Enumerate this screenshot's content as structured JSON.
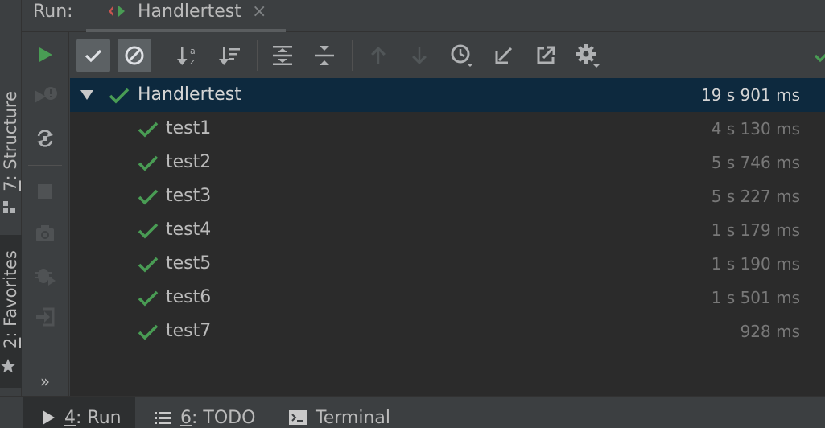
{
  "header": {
    "run_label": "Run:",
    "tab_title": "Handlertest",
    "tab_close": "×"
  },
  "left_strip": {
    "structure_mnemonic": "7",
    "structure_label": ": Structure",
    "favorites_mnemonic": "2",
    "favorites_label": ": Favorites"
  },
  "actions": {
    "more": "»"
  },
  "toolbar": {
    "buttons": [
      {
        "icon": "show-passed-icon",
        "pressed": true
      },
      {
        "icon": "show-ignored-icon",
        "pressed": true
      },
      {
        "icon": "sort-alphabetically-icon",
        "pressed": false
      },
      {
        "icon": "sort-by-duration-icon",
        "pressed": false
      },
      {
        "icon": "expand-all-icon",
        "pressed": false
      },
      {
        "icon": "collapse-all-icon",
        "pressed": false
      },
      {
        "icon": "previous-failed-icon",
        "pressed": false
      },
      {
        "icon": "next-failed-icon",
        "pressed": false
      },
      {
        "icon": "test-history-icon",
        "pressed": false
      },
      {
        "icon": "import-tests-icon",
        "pressed": false
      },
      {
        "icon": "export-results-icon",
        "pressed": false
      },
      {
        "icon": "settings-icon",
        "pressed": false
      }
    ]
  },
  "tree": {
    "root": {
      "name": "Handlertest",
      "time": "19 s 901 ms",
      "status": "passed"
    },
    "tests": [
      {
        "name": "test1",
        "time": "4 s 130 ms",
        "status": "passed"
      },
      {
        "name": "test2",
        "time": "5 s 746 ms",
        "status": "passed"
      },
      {
        "name": "test3",
        "time": "5 s 227 ms",
        "status": "passed"
      },
      {
        "name": "test4",
        "time": "1 s 179 ms",
        "status": "passed"
      },
      {
        "name": "test5",
        "time": "1 s 190 ms",
        "status": "passed"
      },
      {
        "name": "test6",
        "time": "1 s 501 ms",
        "status": "passed"
      },
      {
        "name": "test7",
        "time": "928 ms",
        "status": "passed"
      }
    ]
  },
  "bottom_bar": {
    "tabs": [
      {
        "mnemonic": "4",
        "label": ": Run",
        "active": true
      },
      {
        "mnemonic": "6",
        "label": ": TODO",
        "active": false
      },
      {
        "mnemonic": "",
        "label": "Terminal",
        "active": false
      }
    ]
  },
  "colors": {
    "pass_green": "#499c54",
    "run_green": "#499c54",
    "selection": "#0d293e",
    "background": "#3c3f41",
    "tree_background": "#2b2b2b"
  }
}
